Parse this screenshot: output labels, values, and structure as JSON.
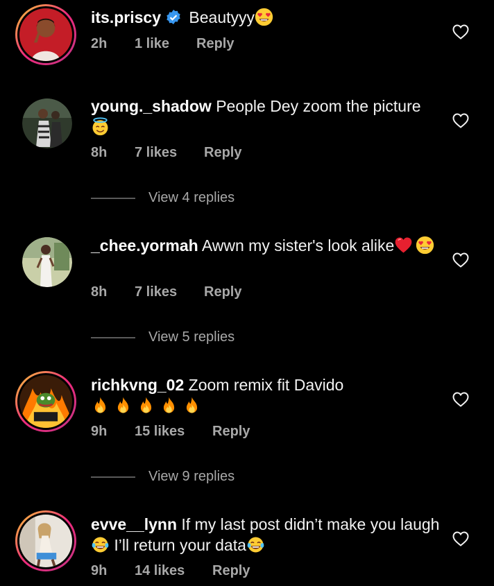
{
  "comments": [
    {
      "username": "its.priscy",
      "verified": true,
      "text": "Beautyyy",
      "emoji_after": [
        "heart-eyes"
      ],
      "time": "2h",
      "likes": "1 like",
      "reply": "Reply",
      "view_replies": null
    },
    {
      "username": "young._shadow",
      "verified": false,
      "text": "People Dey zoom the picture",
      "emoji_after": [
        "smiling-halo"
      ],
      "time": "8h",
      "likes": "7 likes",
      "reply": "Reply",
      "view_replies": "View 4 replies"
    },
    {
      "username": "_chee.yormah",
      "verified": false,
      "text": "Awwn my sister's look alike",
      "emoji_after": [
        "red-heart",
        "heart-eyes"
      ],
      "time": "8h",
      "likes": "7 likes",
      "reply": "Reply",
      "view_replies": "View 5 replies"
    },
    {
      "username": "richkvng_02",
      "verified": false,
      "text": "Zoom remix fit Davido",
      "emoji_after": [
        "fire",
        "fire",
        "fire",
        "fire",
        "fire"
      ],
      "time": "9h",
      "likes": "15 likes",
      "reply": "Reply",
      "view_replies": "View 9 replies"
    },
    {
      "username": "evve__lynn",
      "verified": false,
      "text_part1": "If my last post didn’t make you laugh",
      "text_part2": " I’ll return your data",
      "emoji_mid": "tears-of-joy",
      "emoji_after": [
        "tears-of-joy"
      ],
      "time": "9h",
      "likes": "14 likes",
      "reply": "Reply",
      "view_replies": null
    }
  ],
  "colors": {
    "background": "#000000",
    "text": "#f2f2f2",
    "muted": "#a8a8a8",
    "verified_blue": "#3897f0",
    "story_ring_start": "#f9ce34",
    "story_ring_end": "#c13584"
  }
}
